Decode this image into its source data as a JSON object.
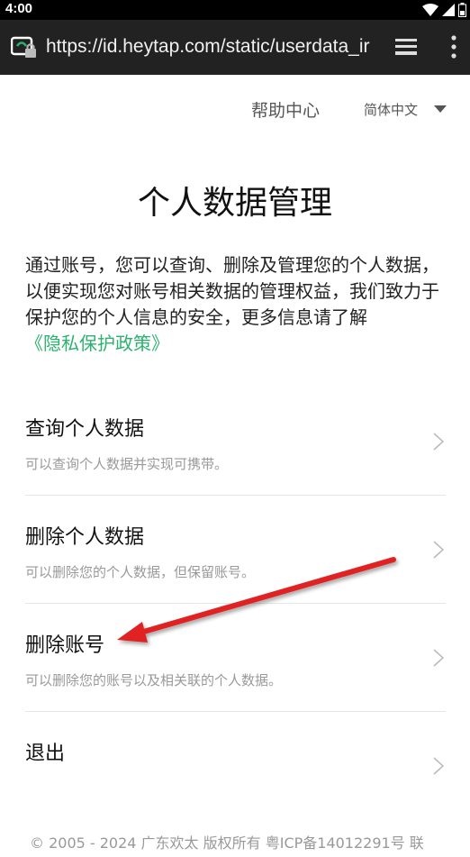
{
  "status_bar": {
    "time": "4:00"
  },
  "browser": {
    "url": "https://id.heytap.com/static/userdata_ir"
  },
  "header": {
    "help_center": "帮助中心",
    "language": "简体中文"
  },
  "page": {
    "title": "个人数据管理",
    "intro_text": "通过账号，您可以查询、删除及管理您的个人数据，以便实现您对账号相关数据的管理权益，我们致力于保护您的个人信息的安全，更多信息请了解",
    "policy_link": "《隐私保护政策》"
  },
  "menu": {
    "items": [
      {
        "title": "查询个人数据",
        "desc": "可以查询个人数据并实现可携带。"
      },
      {
        "title": "删除个人数据",
        "desc": "可以删除您的个人数据，但保留账号。"
      },
      {
        "title": "删除账号",
        "desc": "可以删除您的账号以及相关联的个人数据。"
      },
      {
        "title": "退出",
        "desc": ""
      }
    ]
  },
  "footer": {
    "copyright": "© 2005 - 2024 广东欢太 版权所有 粤ICP备14012291号 联"
  },
  "colors": {
    "accent": "#2cb26f",
    "annotation": "#e02020",
    "address_bar": "#222222"
  }
}
